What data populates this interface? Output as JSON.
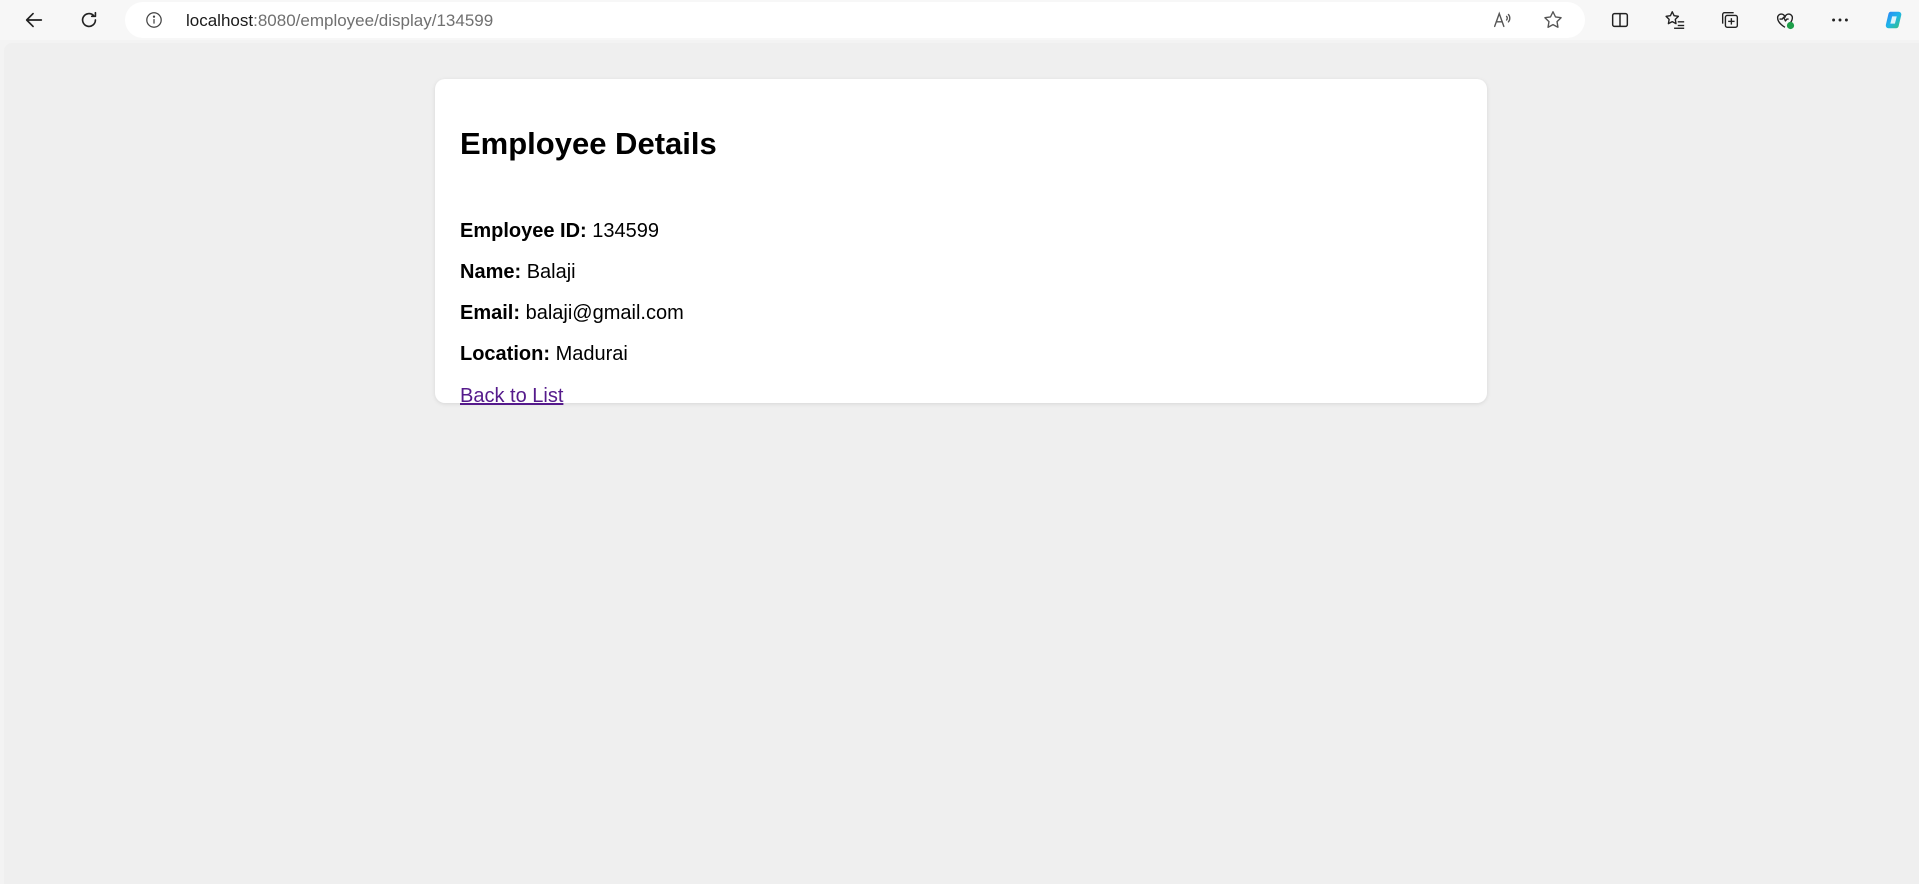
{
  "browser": {
    "url_host": "localhost",
    "url_path": ":8080/employee/display/134599",
    "icons": {
      "back": "back-arrow-icon",
      "refresh": "refresh-icon",
      "info": "info-icon",
      "read_aloud": "read-aloud-icon",
      "favorite": "star-icon",
      "split_screen": "split-screen-icon",
      "favorites": "favorites-list-icon",
      "collections": "collections-icon",
      "health": "browser-essentials-icon",
      "more": "more-icon",
      "copilot": "copilot-icon"
    }
  },
  "page": {
    "title": "Employee Details",
    "fields": [
      {
        "label": "Employee ID:",
        "value": "134599"
      },
      {
        "label": "Name:",
        "value": "Balaji"
      },
      {
        "label": "Email:",
        "value": "balaji@gmail.com"
      },
      {
        "label": "Location:",
        "value": "Madurai"
      }
    ],
    "back_link": "Back to List"
  },
  "colors": {
    "link_visited": "#551a8b",
    "page_bg": "#efefef",
    "card_bg": "#ffffff"
  }
}
